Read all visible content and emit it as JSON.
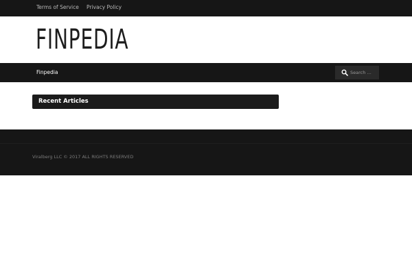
{
  "top_menu": {
    "items": [
      {
        "label": "Terms of Service"
      },
      {
        "label": "Privacy Policy"
      }
    ]
  },
  "site": {
    "logo_text": "FINPEDIA"
  },
  "main_nav": {
    "items": [
      {
        "label": "Finpedia"
      }
    ],
    "search": {
      "placeholder": "Search …",
      "value": "",
      "icon": "search-icon"
    }
  },
  "sidebar_widget": {
    "title": "Recent Articles"
  },
  "footer": {
    "copyright": "Viralberg LLC © 2017 ALL RIGHTS RESERVED"
  },
  "colors": {
    "bar_background": "#161616",
    "widget_background": "#1b1b1b",
    "search_background": "#2a2a2a",
    "page_background": "#ffffff"
  }
}
